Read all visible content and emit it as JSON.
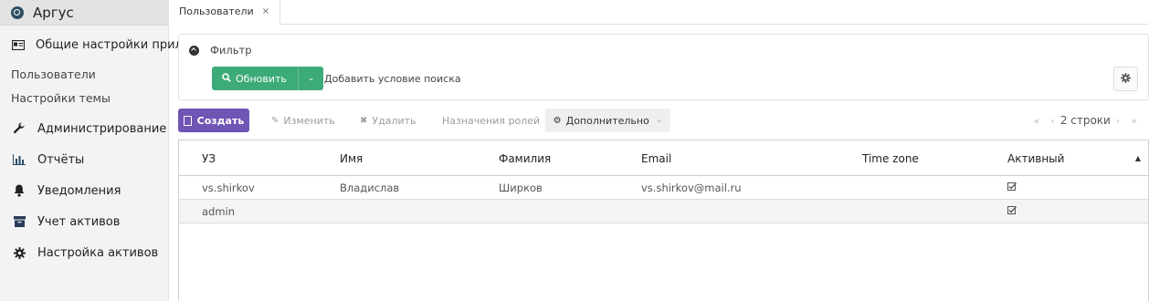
{
  "app": {
    "title": "Аргус"
  },
  "sidebar": {
    "group_general": "Общие настройки прило...",
    "sub_items": [
      {
        "label": "Пользователи"
      },
      {
        "label": "Настройки темы"
      }
    ],
    "groups": [
      {
        "label": "Администрирование",
        "icon": "wrench-icon"
      },
      {
        "label": "Отчёты",
        "icon": "bar-chart-icon"
      },
      {
        "label": "Уведомления",
        "icon": "bell-icon"
      },
      {
        "label": "Учет активов",
        "icon": "archive-icon"
      },
      {
        "label": "Настройка активов",
        "icon": "gear-icon"
      }
    ]
  },
  "tabs": [
    {
      "label": "Пользователи",
      "close": "×"
    }
  ],
  "filter": {
    "title": "Фильтр",
    "refresh_label": "Обновить",
    "add_condition": "Добавить условие поиска"
  },
  "toolbar": {
    "create": "Создать",
    "edit": "Изменить",
    "delete": "Удалить",
    "roles": "Назначения ролей",
    "more": "Дополнительно"
  },
  "pager": {
    "first": "«",
    "prev": "‹",
    "label": "2 строки",
    "next": "›",
    "last": "»"
  },
  "table": {
    "columns": [
      "УЗ",
      "Имя",
      "Фамилия",
      "Email",
      "Time zone",
      "Активный"
    ],
    "rows": [
      {
        "account": "vs.shirkov",
        "first_name": "Владислав",
        "last_name": "Ширков",
        "email": "vs.shirkov@mail.ru",
        "timezone": "",
        "active": true
      },
      {
        "account": "admin",
        "first_name": "",
        "last_name": "",
        "email": "",
        "timezone": "",
        "active": true
      }
    ]
  },
  "colors": {
    "accent_green": "#3cab78",
    "accent_purple": "#6f55b4"
  }
}
